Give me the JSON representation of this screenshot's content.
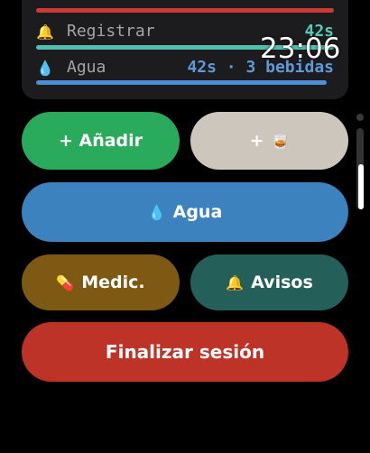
{
  "summary": {
    "rows": [
      {
        "icon": "bell-icon",
        "glyph": "🔔",
        "label": "Registrar",
        "value": "42s"
      },
      {
        "icon": "water-drop-icon",
        "glyph": "💧",
        "label": "Agua",
        "value": "42s · 3 bebidas"
      }
    ]
  },
  "status_bar": {
    "time": "23:06"
  },
  "buttons": {
    "add_label": "+ Añadir",
    "drink_plus": "+",
    "drink_glyph": "🥃",
    "water_glyph": "💧",
    "water_label": "Agua",
    "med_glyph": "💊",
    "med_label": "Medic.",
    "alerts_glyph": "🔔",
    "alerts_label": "Avisos",
    "end_label": "Finalizar sesión"
  },
  "colors": {
    "add": "#2aaa5b",
    "drink": "#cdc6bc",
    "water": "#3b82be",
    "med": "#7d5914",
    "alerts": "#245f59",
    "end": "#bd3328"
  }
}
